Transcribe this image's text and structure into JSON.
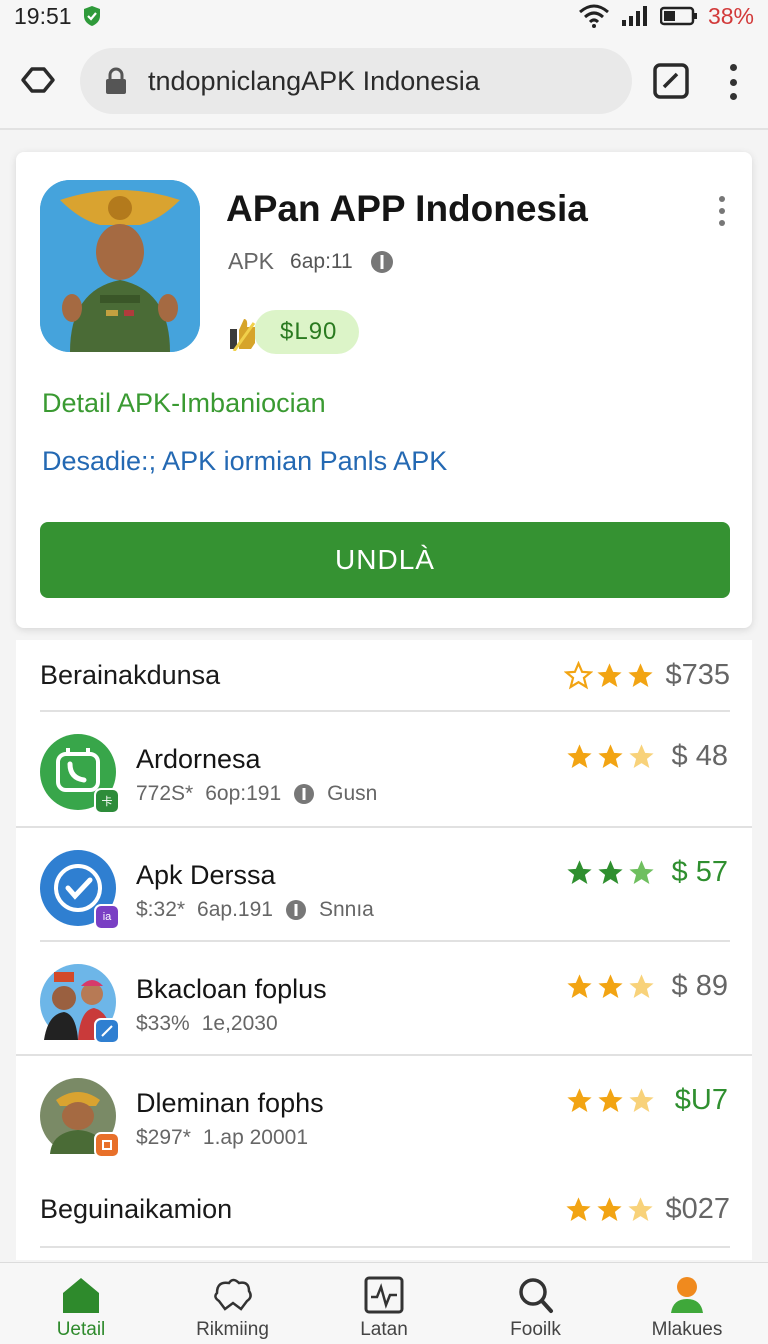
{
  "status": {
    "time": "19:51",
    "battery": "38%"
  },
  "browser": {
    "url": "tndopniclangAPK Indonesia"
  },
  "app": {
    "title": "APan APP Indonesia",
    "meta_type": "APK",
    "meta_version": "6ap:11",
    "price": "$L90",
    "detail_link": "Detail APK-Imbaniocian",
    "desc_link": "Desadie:; APK iormian Panls APK",
    "install_label": "UNDLÀ"
  },
  "sections": [
    {
      "title": "Berainakdunsa",
      "price": "$735",
      "price_color": "#666666",
      "stars": [
        "empty",
        "full",
        "full"
      ]
    },
    {
      "title": "Beguinaikamion",
      "price": "$027",
      "price_color": "#666666",
      "stars": [
        "full",
        "full",
        "half"
      ]
    }
  ],
  "apps": [
    {
      "name": "Ardornesa",
      "meta1": "772S*",
      "meta2": "6op:191",
      "meta3": "Gusn",
      "price": "$ 48",
      "price_color": "#666666",
      "star_color": "#f2a413",
      "icon": "phone-app-icon",
      "badge": "卡"
    },
    {
      "name": "Apk Derssa",
      "meta1": "$:32*",
      "meta2": "6ap.191",
      "meta3": "Snnıa",
      "price": "$ 57",
      "price_color": "#2f8f2f",
      "star_color": "#2f8f2f",
      "icon": "check-app-icon",
      "badge": "ia"
    },
    {
      "name": "Bkacloan foplus",
      "meta1": "$33%",
      "meta2": "1e,2030",
      "meta3": "",
      "price": "$ 89",
      "price_color": "#666666",
      "star_color": "#f2a413",
      "icon": "group-app-icon",
      "badge": ""
    },
    {
      "name": "Dlеminan fophs",
      "meta1": "$297*",
      "meta2": "1.ap 20001",
      "meta3": "",
      "price": "$U7",
      "price_color": "#2f8f2f",
      "star_color": "#f2a413",
      "icon": "soldier-app-icon",
      "badge": ""
    }
  ],
  "nav": [
    {
      "label": "Uetail",
      "icon": "home-icon",
      "active": true
    },
    {
      "label": "Rikmiing",
      "icon": "puzzle-icon",
      "active": false
    },
    {
      "label": "Latan",
      "icon": "chart-icon",
      "active": false
    },
    {
      "label": "Fooilk",
      "icon": "search-icon",
      "active": false
    },
    {
      "label": "Mlakues",
      "icon": "profile-icon",
      "active": false
    }
  ],
  "colors": {
    "accent": "#359232",
    "link": "#2469b3",
    "star": "#f2a413"
  }
}
